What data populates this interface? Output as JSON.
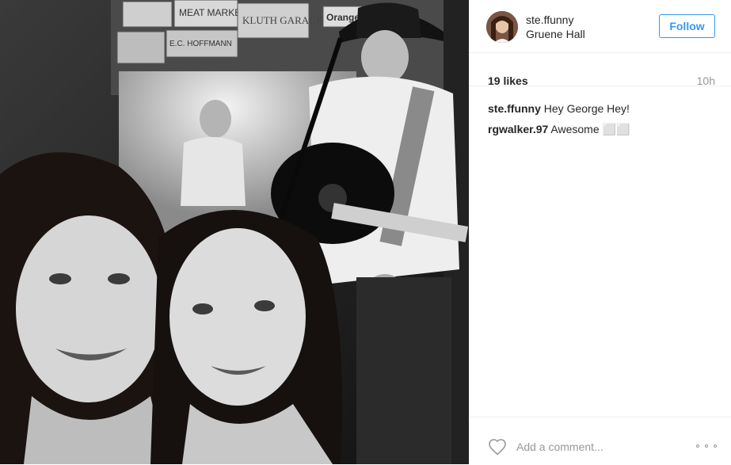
{
  "post": {
    "author": {
      "username": "ste.ffunny",
      "location": "Gruene Hall"
    },
    "follow_label": "Follow",
    "likes": "19 likes",
    "time": "10h",
    "comments": [
      {
        "user": "ste.ffunny",
        "text": "Hey George Hey!"
      },
      {
        "user": "rgwalker.97",
        "text": "Awesome ⬜⬜"
      }
    ],
    "add_comment_placeholder": "Add a comment...",
    "photo": {
      "signs": [
        "MEAT MARKET",
        "KLUTH GARAGE",
        "E.C. HOFFMANN",
        "Orange"
      ]
    }
  },
  "colors": {
    "accent": "#3897f0",
    "muted": "#999999",
    "text": "#262626"
  },
  "icons": {
    "like": "heart-icon",
    "options": "more-options-icon"
  }
}
